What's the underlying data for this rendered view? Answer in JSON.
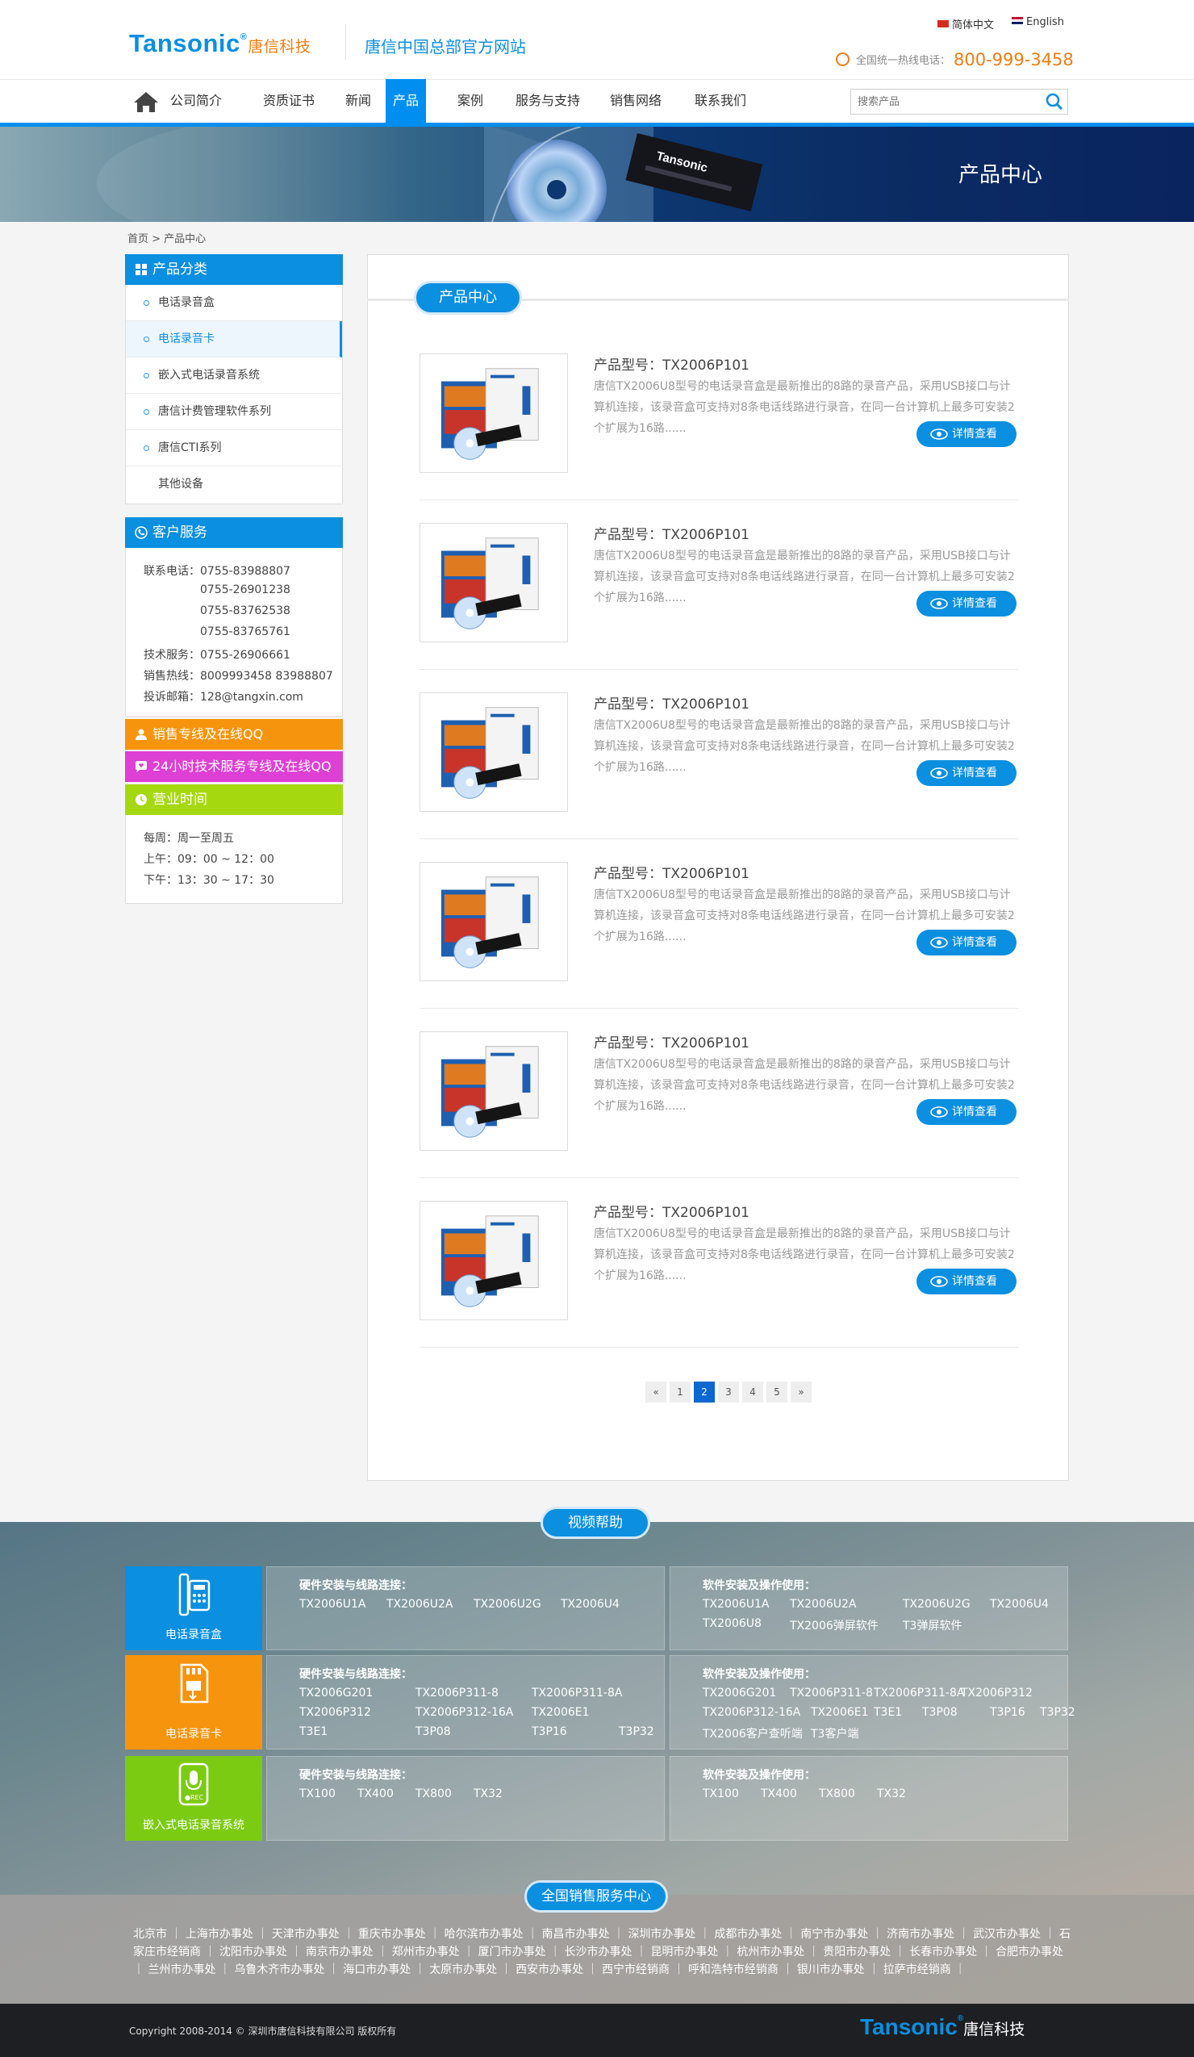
{
  "header": {
    "logo": "Tansonic",
    "logo_reg": "®",
    "logo_cn": "唐信科技",
    "site_name": "唐信中国总部官方网站",
    "lang_cn": "简体中文",
    "lang_en": "English",
    "hotline_label": "全国统一热线电话：",
    "hotline_number": "800-999-3458"
  },
  "nav": {
    "items": [
      "公司简介",
      "资质证书",
      "新闻",
      "产品",
      "案例",
      "服务与支持",
      "销售网络",
      "联系我们"
    ],
    "active": "产品",
    "search_placeholder": "搜索产品"
  },
  "banner": {
    "title": "产品中心",
    "product_label": "Tansonic"
  },
  "breadcrumb": "首页 > 产品中心",
  "sidebar": {
    "categories_title": "产品分类",
    "categories": [
      "电话录音盒",
      "电话录音卡",
      "嵌入式电话录音系统",
      "唐信计费管理软件系列",
      "唐信CTI系列",
      "其他设备"
    ],
    "active_category": "电话录音卡",
    "service_title": "客户服务",
    "service_lines": [
      "联系电话：0755-83988807",
      "0755-26901238",
      "0755-83762538",
      "0755-83765761",
      "技术服务：0755-26906661",
      "销售热线：8009993458 83988807",
      "投诉邮箱：128@tangxin.com"
    ],
    "sales_qq": "销售专线及在线QQ",
    "tech_qq": "24小时技术服务专线及在线QQ",
    "hours_title": "营业时间",
    "hours_lines": [
      "每周：周一至周五",
      "上午：09：00 ~ 12：00",
      "下午：13：30 ~ 17：30"
    ]
  },
  "content": {
    "tab_title": "产品中心",
    "products": [
      {
        "title": "产品型号：TX2006P101",
        "desc": "唐信TX2006U8型号的电话录音盒是最新推出的8路的录音产品，采用USB接口与计算机连接，该录音盒可支持对8条电话线路进行录音，在同一台计算机上最多可安装2个扩展为16路......",
        "button": "详情查看"
      },
      {
        "title": "产品型号：TX2006P101",
        "desc": "唐信TX2006U8型号的电话录音盒是最新推出的8路的录音产品，采用USB接口与计算机连接，该录音盒可支持对8条电话线路进行录音，在同一台计算机上最多可安装2个扩展为16路......",
        "button": "详情查看"
      },
      {
        "title": "产品型号：TX2006P101",
        "desc": "唐信TX2006U8型号的电话录音盒是最新推出的8路的录音产品，采用USB接口与计算机连接，该录音盒可支持对8条电话线路进行录音，在同一台计算机上最多可安装2个扩展为16路......",
        "button": "详情查看"
      },
      {
        "title": "产品型号：TX2006P101",
        "desc": "唐信TX2006U8型号的电话录音盒是最新推出的8路的录音产品，采用USB接口与计算机连接，该录音盒可支持对8条电话线路进行录音，在同一台计算机上最多可安装2个扩展为16路......",
        "button": "详情查看"
      },
      {
        "title": "产品型号：TX2006P101",
        "desc": "唐信TX2006U8型号的电话录音盒是最新推出的8路的录音产品，采用USB接口与计算机连接，该录音盒可支持对8条电话线路进行录音，在同一台计算机上最多可安装2个扩展为16路......",
        "button": "详情查看"
      },
      {
        "title": "产品型号：TX2006P101",
        "desc": "唐信TX2006U8型号的电话录音盒是最新推出的8路的录音产品，采用USB接口与计算机连接，该录音盒可支持对8条电话线路进行录音，在同一台计算机上最多可安装2个扩展为16路......",
        "button": "详情查看"
      }
    ],
    "pagination": [
      "«",
      "1",
      "2",
      "3",
      "4",
      "5",
      "»"
    ],
    "current_page": "2"
  },
  "video": {
    "title": "视频帮助",
    "rows": [
      {
        "tile": "电话录音盒",
        "tile_color": "#0b8fe0",
        "hw_title": "硬件安装与线路连接：",
        "hw_links": [
          "TX2006U1A",
          "TX2006U2A",
          "TX2006U2G",
          "TX2006U4"
        ],
        "sw_title": "软件安装及操作使用：",
        "sw_links": [
          "TX2006U1A",
          "TX2006U2A",
          "TX2006U2G",
          "TX2006U4",
          "TX2006U8",
          "TX2006弹屏软件",
          "T3弹屏软件"
        ]
      },
      {
        "tile": "电话录音卡",
        "tile_color": "#f7940d",
        "hw_title": "硬件安装与线路连接：",
        "hw_links": [
          "TX2006G201",
          "TX2006P311-8",
          "TX2006P311-8A",
          "TX2006P312",
          "TX2006P312-16A",
          "TX2006E1",
          "T3E1",
          "T3P08",
          "T3P16",
          "T3P32"
        ],
        "sw_title": "软件安装及操作使用：",
        "sw_links": [
          "TX2006G201",
          "TX2006P311-8",
          "TX2006P311-8A",
          "TX2006P312",
          "TX2006P312-16A",
          "TX2006E1",
          "T3E1",
          "T3P08",
          "T3P16",
          "T3P32",
          "TX2006客户查听端",
          "T3客户端"
        ]
      },
      {
        "tile": "嵌入式电话录音系统",
        "tile_color": "#7ccb13",
        "hw_title": "硬件安装与线路连接：",
        "hw_links": [
          "TX100",
          "TX400",
          "TX800",
          "TX32"
        ],
        "sw_title": "软件安装及操作使用：",
        "sw_links": [
          "TX100",
          "TX400",
          "TX800",
          "TX32"
        ]
      }
    ]
  },
  "offices": {
    "title": "全国销售服务中心",
    "items": [
      "北京市",
      "上海市办事处",
      "天津市办事处",
      "重庆市办事处",
      "哈尔滨市办事处",
      "南昌市办事处",
      "深圳市办事处",
      "成都市办事处",
      "南宁市办事处",
      "济南市办事处",
      "武汉市办事处",
      "石家庄市经销商",
      "沈阳市办事处",
      "南京市办事处",
      "郑州市办事处",
      "厦门市办事处",
      "长沙市办事处",
      "昆明市办事处",
      "杭州市办事处",
      "贵阳市办事处",
      "长春市办事处",
      "合肥市办事处",
      "兰州市办事处",
      "乌鲁木齐市办事处",
      "海口市办事处",
      "太原市办事处",
      "西安市办事处",
      "西宁市经销商",
      "呼和浩特市经销商",
      "银川市办事处",
      "拉萨市经销商"
    ]
  },
  "footer": {
    "copyright": "Copyright 2008-2014 © 深圳市唐信科技有限公司 版权所有",
    "logo": "Tansonic",
    "logo_cn": "唐信科技"
  },
  "colors": {
    "primary": "#0b8fe0",
    "orange": "#f7940d",
    "magenta": "#de3fd4",
    "green": "#a6d80f",
    "footer": "#1d1f22"
  }
}
